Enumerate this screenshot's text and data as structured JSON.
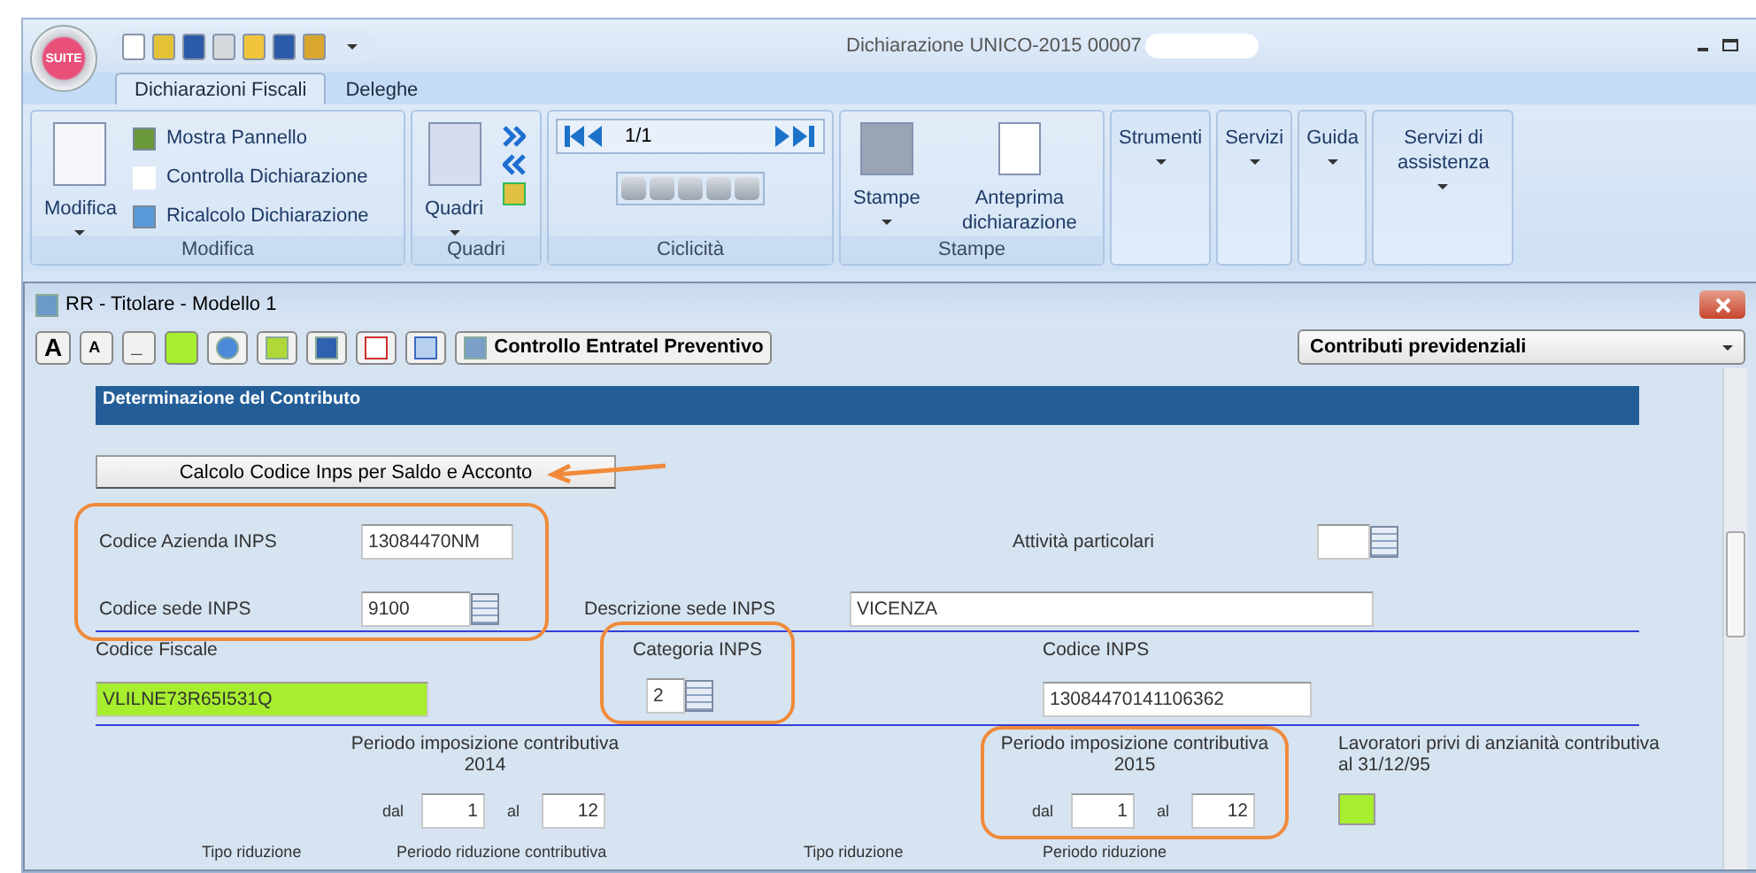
{
  "app": {
    "logo": "SUITE",
    "title": "Dichiarazione UNICO-2015 00007",
    "tabs": [
      {
        "label": "Dichiarazioni Fiscali",
        "selected": true
      },
      {
        "label": "Deleghe",
        "selected": false
      }
    ],
    "ribbon": {
      "modifica": {
        "button": "Modifica",
        "items": [
          "Mostra Pannello",
          "Controlla Dichiarazione",
          "Ricalcolo Dichiarazione"
        ],
        "label": "Modifica"
      },
      "quadri": {
        "button": "Quadri",
        "label": "Quadri"
      },
      "ciclicita": {
        "page": "1/1",
        "label": "Ciclicità"
      },
      "stampe": {
        "buttons": [
          "Stampe",
          "Anteprima dichiarazione"
        ],
        "label": "Stampe"
      },
      "menus": [
        "Strumenti",
        "Servizi",
        "Guida",
        "Servizi di assistenza"
      ]
    }
  },
  "form_window": {
    "title": "RR - Titolare - Modello 1",
    "toolbar": {
      "font_large": "A",
      "font_small": "A",
      "underscore": "_",
      "check_button": "Controllo Entratel Preventivo"
    },
    "section_select": "Contributi previdenziali",
    "section_title": "Determinazione del Contributo",
    "calc_button": "Calcolo Codice Inps per Saldo e Acconto",
    "codice_azienda": {
      "label": "Codice Azienda INPS",
      "value": "13084470NM"
    },
    "attivita_particolari": {
      "label": "Attività particolari"
    },
    "codice_sede": {
      "label": "Codice sede INPS",
      "value": "9100"
    },
    "descrizione_sede": {
      "label": "Descrizione sede INPS",
      "value": "VICENZA"
    },
    "codice_fiscale": {
      "label": "Codice Fiscale",
      "value": "VLILNE73R65I531Q",
      "highlighted": true
    },
    "categoria": {
      "label": "Categoria INPS",
      "value": "2"
    },
    "codice_inps": {
      "label": "Codice INPS",
      "value": "13084470141106362",
      "highlighted": false
    },
    "periods": [
      {
        "title": "Periodo imposizione contributiva",
        "year": "2014",
        "from_label": "dal",
        "from": "1",
        "to_label": "al",
        "to": "12"
      },
      {
        "title": "Periodo imposizione contributiva",
        "year": "2015",
        "from_label": "dal",
        "from": "1",
        "to_label": "al",
        "to": "12"
      }
    ],
    "lavoratori": {
      "label": "Lavoratori privi di anzianità contributiva al 31/12/95",
      "highlighted": true
    },
    "bottom_labels": [
      "Tipo riduzione",
      "Periodo riduzione contributiva",
      "Tipo riduzione",
      "Periodo riduzione"
    ]
  }
}
